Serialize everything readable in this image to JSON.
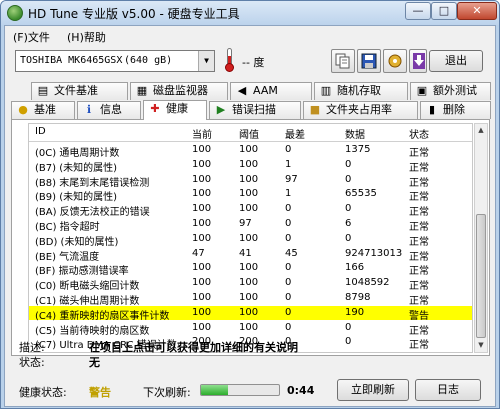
{
  "window": {
    "title": "HD Tune 专业版 v5.00 - 硬盘专业工具",
    "min_label": "—",
    "max_label": "□",
    "close_label": "✕"
  },
  "menu": {
    "file": "(F)文件",
    "help": "(H)帮助"
  },
  "toolbar": {
    "drive_name": "TOSHIBA MK6465GSX",
    "drive_capacity": "(640 gB)",
    "temperature": "-- 度",
    "exit_label": "退出"
  },
  "tabs_row1": [
    {
      "icon": "file-benchmark-icon",
      "label": "文件基准"
    },
    {
      "icon": "disk-monitor-icon",
      "label": "磁盘监视器"
    },
    {
      "icon": "speaker-icon",
      "label": "AAM"
    },
    {
      "icon": "random-access-icon",
      "label": "随机存取"
    },
    {
      "icon": "extra-tests-icon",
      "label": "额外测试"
    }
  ],
  "tabs_row2": [
    {
      "icon": "lightbulb-icon",
      "label": "基准"
    },
    {
      "icon": "info-icon",
      "label": "信息"
    },
    {
      "icon": "health-cross-icon",
      "label": "健康"
    },
    {
      "icon": "error-scan-icon",
      "label": "错误扫描"
    },
    {
      "icon": "folder-usage-icon",
      "label": "文件夹占用率"
    },
    {
      "icon": "erase-icon",
      "label": "删除"
    }
  ],
  "table": {
    "headers": {
      "id": "ID",
      "current": "当前",
      "threshold": "阈值",
      "worst": "最差",
      "data": "数据",
      "status": "状态"
    },
    "rows": [
      {
        "id": "(0C) 通电周期计数",
        "current": "100",
        "threshold": "100",
        "worst": "0",
        "data": "1375",
        "status": "正常"
      },
      {
        "id": "(B7) (未知的属性)",
        "current": "100",
        "threshold": "100",
        "worst": "1",
        "data": "0",
        "status": "正常"
      },
      {
        "id": "(B8) 末尾到末尾错误检测",
        "current": "100",
        "threshold": "100",
        "worst": "97",
        "data": "0",
        "status": "正常"
      },
      {
        "id": "(B9) (未知的属性)",
        "current": "100",
        "threshold": "100",
        "worst": "1",
        "data": "65535",
        "status": "正常"
      },
      {
        "id": "(BA) 反馈无法校正的错误",
        "current": "100",
        "threshold": "100",
        "worst": "0",
        "data": "0",
        "status": "正常"
      },
      {
        "id": "(BC) 指令超时",
        "current": "100",
        "threshold": "97",
        "worst": "0",
        "data": "6",
        "status": "正常"
      },
      {
        "id": "(BD) (未知的属性)",
        "current": "100",
        "threshold": "100",
        "worst": "0",
        "data": "0",
        "status": "正常"
      },
      {
        "id": "(BE) 气流温度",
        "current": "47",
        "threshold": "41",
        "worst": "45",
        "data": "924713013",
        "status": "正常"
      },
      {
        "id": "(BF) 振动感测错误率",
        "current": "100",
        "threshold": "100",
        "worst": "0",
        "data": "166",
        "status": "正常"
      },
      {
        "id": "(C0) 断电磁头缩回计数",
        "current": "100",
        "threshold": "100",
        "worst": "0",
        "data": "1048592",
        "status": "正常"
      },
      {
        "id": "(C1) 磁头伸出周期计数",
        "current": "100",
        "threshold": "100",
        "worst": "0",
        "data": "8798",
        "status": "正常"
      },
      {
        "id": "(C4) 重新映射的扇区事件计数",
        "current": "100",
        "threshold": "100",
        "worst": "0",
        "data": "190",
        "status": "警告",
        "warning": true
      },
      {
        "id": "(C5) 当前待映射的扇区数",
        "current": "100",
        "threshold": "100",
        "worst": "0",
        "data": "0",
        "status": "正常"
      },
      {
        "id": "(C7) Ultra DMA CRC 错误计数",
        "current": "200",
        "threshold": "200",
        "worst": "0",
        "data": "0",
        "status": "正常"
      }
    ]
  },
  "description": {
    "label": "描述:",
    "value": "在项目上点击可以获得更加详细的有关说明"
  },
  "state": {
    "label": "状态:",
    "value": "无"
  },
  "footer": {
    "health_label": "健康状态:",
    "health_value": "警告",
    "next_refresh_label": "下次刷新:",
    "progress": 0.35,
    "timer": "0:44",
    "refresh_button": "立即刷新",
    "log_button": "日志"
  },
  "colors": {
    "warning_row": "#ffff00",
    "health_warning": "#c0a000"
  }
}
